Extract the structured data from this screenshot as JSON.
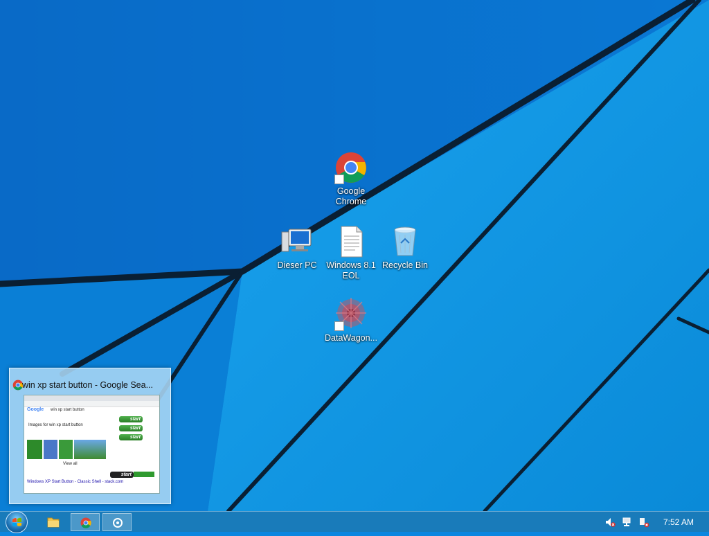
{
  "desktop": {
    "icons": [
      {
        "label": "Google\nChrome",
        "icon": "chrome-icon"
      },
      {
        "label": "Dieser PC",
        "icon": "computer-icon"
      },
      {
        "label": "Windows 8.1\nEOL",
        "icon": "text-document-icon"
      },
      {
        "label": "Recycle Bin",
        "icon": "recycle-bin-icon"
      },
      {
        "label": "DataWagon...",
        "icon": "datawagon-icon"
      }
    ]
  },
  "preview": {
    "title": "win xp start button - Google Sea...",
    "thumbnail_text": {
      "search": "win xp start button",
      "images_heading": "Images for win xp start button",
      "result_link": "Windows XP Start Button - Classic Shell - stack.com",
      "more": "View all",
      "start_label": "start"
    }
  },
  "taskbar": {
    "clock": "7:52 AM"
  },
  "colors": {
    "wallpaper_blue": "#0b86e0",
    "taskbar": "#1e78af"
  }
}
